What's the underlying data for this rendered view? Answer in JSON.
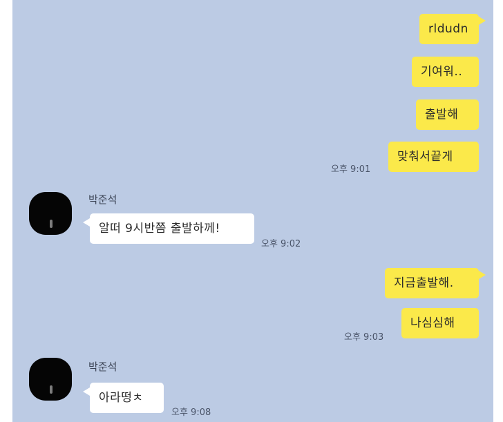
{
  "chat": {
    "background": "#bccbe4",
    "outgoing_color": "#fbe94a",
    "incoming_color": "#ffffff",
    "messages": [
      {
        "text": "rldudn"
      },
      {
        "text": "기여워.."
      },
      {
        "text": "출발해"
      },
      {
        "text": "맞춰서끝게",
        "time": "오후 9:01"
      },
      {
        "sender": "박준석",
        "text": "알떠 9시반쯤 출발하께!",
        "time": "오후 9:02"
      },
      {
        "text": "지금출발해."
      },
      {
        "text": "나심심해",
        "time": "오후 9:03"
      },
      {
        "sender": "박준석",
        "text": "아라떵ㅊ",
        "time": "오후 9:08"
      }
    ]
  },
  "avatar_icon": "profile-photo-dark"
}
